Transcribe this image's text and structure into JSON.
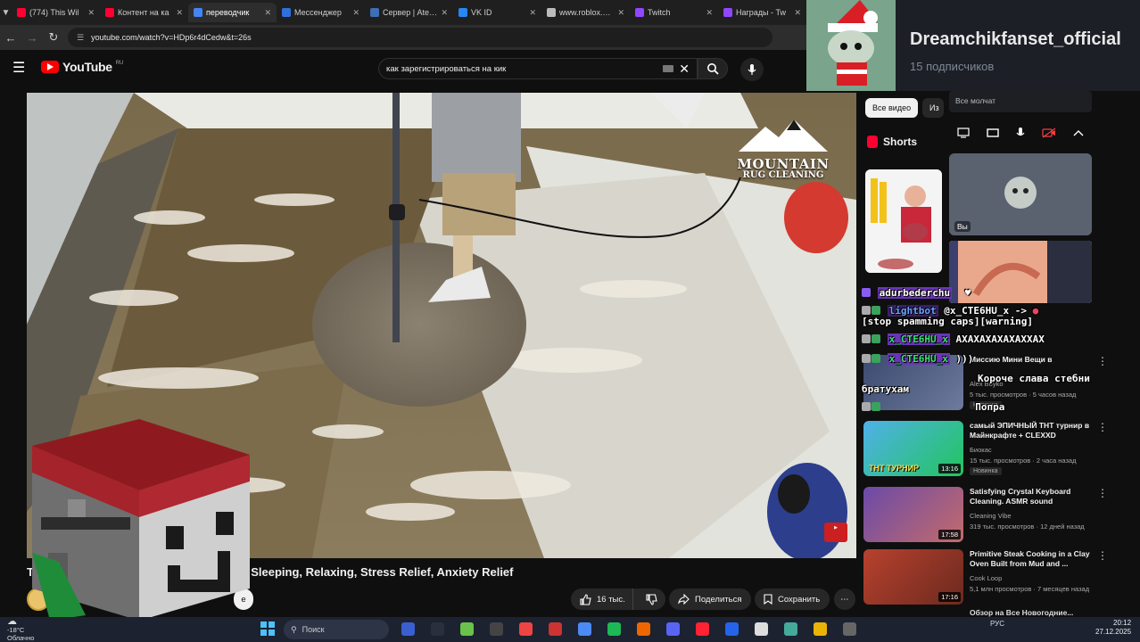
{
  "browser": {
    "tabs": [
      {
        "label": "(774) This Wil",
        "color": "#ff0033",
        "active": false
      },
      {
        "label": "Контент на ка",
        "color": "#ff0033",
        "active": false
      },
      {
        "label": "переводчик",
        "color": "#4285f4",
        "active": true
      },
      {
        "label": "Мессенджер",
        "color": "#2f6fe0",
        "active": false
      },
      {
        "label": "Сервер | Aternos",
        "color": "#3b6fb6",
        "active": false
      },
      {
        "label": "VK ID",
        "color": "#2787f5",
        "active": false
      },
      {
        "label": "www.roblox.com",
        "color": "#bbbbbb",
        "active": false
      },
      {
        "label": "Twitch",
        "color": "#9146ff",
        "active": false
      },
      {
        "label": "Награды - Tw",
        "color": "#9146ff",
        "active": false
      }
    ],
    "url": "youtube.com/watch?v=HDp6r4dCedw&t=26s"
  },
  "youtube": {
    "logo_text": "YouTube",
    "logo_region": "RU",
    "search_query": "как зарегистрироваться на кик",
    "video": {
      "overlay_brand_line1": "MOUNTAIN",
      "overlay_brand_line2": "RUG CLEANING",
      "title_visible": "Sleeping, Relaxing, Stress Relief, Anxiety Relief",
      "title_prefix": "T",
      "channel_partial": "U",
      "likes": "16 тыс.",
      "share_label": "Поделиться",
      "save_label": "Сохранить",
      "subscribe_fragment": "е"
    },
    "chips": {
      "all": "Все видео",
      "from": "Из"
    },
    "shorts_label": "Shorts",
    "recommendations": [
      {
        "title": "Миссию Мини Вещи в",
        "channel": "Alex Boyko",
        "meta": "5 тыс. просмотров · 5 часов назад",
        "badge": "Новинка",
        "duration": ""
      },
      {
        "title": "самый ЭПИЧНЫЙ ТНТ турнир в Майнкрафте + CLEXXD",
        "channel": "Биокас",
        "meta": "15 тыс. просмотров · 2 часа назад",
        "badge": "Новинка",
        "duration": "13:16",
        "thumb_text": "ТНТ ТУРНИР"
      },
      {
        "title": "Satisfying Crystal Keyboard Cleaning. ASMR sound",
        "channel": "Cleaning Vibe",
        "meta": "319 тыс. просмотров · 12 дней назад",
        "badge": "",
        "duration": "17:58"
      },
      {
        "title": "Primitive Steak Cooking in a Clay Oven Built from Mud and ...",
        "channel": "Cook Loop",
        "meta": "5,1 млн просмотров · 7 месяцев назад",
        "badge": "",
        "duration": "17:16"
      }
    ],
    "partial_bottom": "Обзор на Все Новогодние..."
  },
  "telegram": {
    "channel_name": "Dreamchikfanset_official",
    "subscribers": "15 подписчиков"
  },
  "discord": {
    "quiet_label": "Все молчат",
    "you_label": "Вы"
  },
  "chat": [
    {
      "user": "adurbederchu",
      "text": ""
    },
    {
      "user": "lightbot",
      "text": "@x_CTE6HU_x ->",
      "extra": "[stop spamming caps][warning]"
    },
    {
      "user": "x_CTE6HU_x",
      "text": "АХАХАХАХАХАХХАХ"
    },
    {
      "user": "x_CTE6HU_x",
      "text": ")))"
    },
    {
      "user": "",
      "text": "Короче слава стебни"
    },
    {
      "user": "",
      "text": "братухам"
    },
    {
      "user": "",
      "text": "Попра"
    }
  ],
  "taskbar": {
    "temperature": "-18°C",
    "weather": "Облачно",
    "search_label": "Поиск",
    "language": "РУС",
    "time": "20:12",
    "date": "27.12.2025"
  }
}
